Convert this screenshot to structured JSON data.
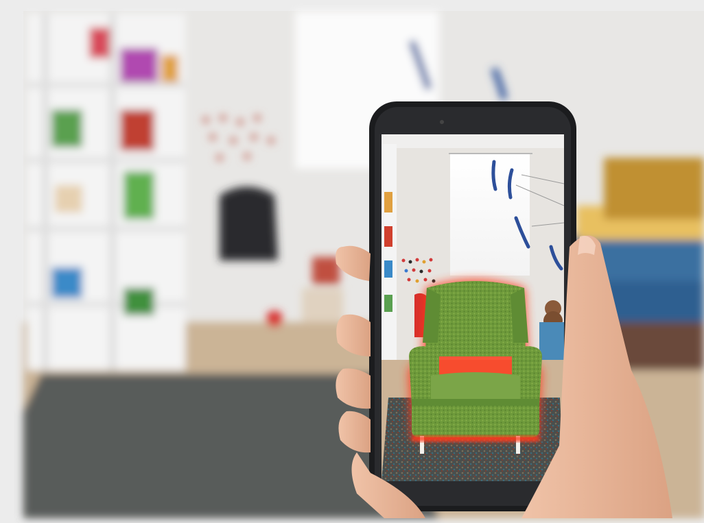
{
  "scene": {
    "background_room": {
      "wall": "#e9e8e6",
      "floor": "#c9b394",
      "rug": "#565a58",
      "shelf": "#f1f1f1"
    },
    "phone": {
      "body": "#1d1e20",
      "screen_wall": "#e6e3df"
    },
    "armchair": {
      "fabric": "#6e9a3b",
      "fabric_dark": "#4f7a2b",
      "highlight_glow": "#ff3a1a"
    },
    "hand_skin": "#e9b79a"
  }
}
